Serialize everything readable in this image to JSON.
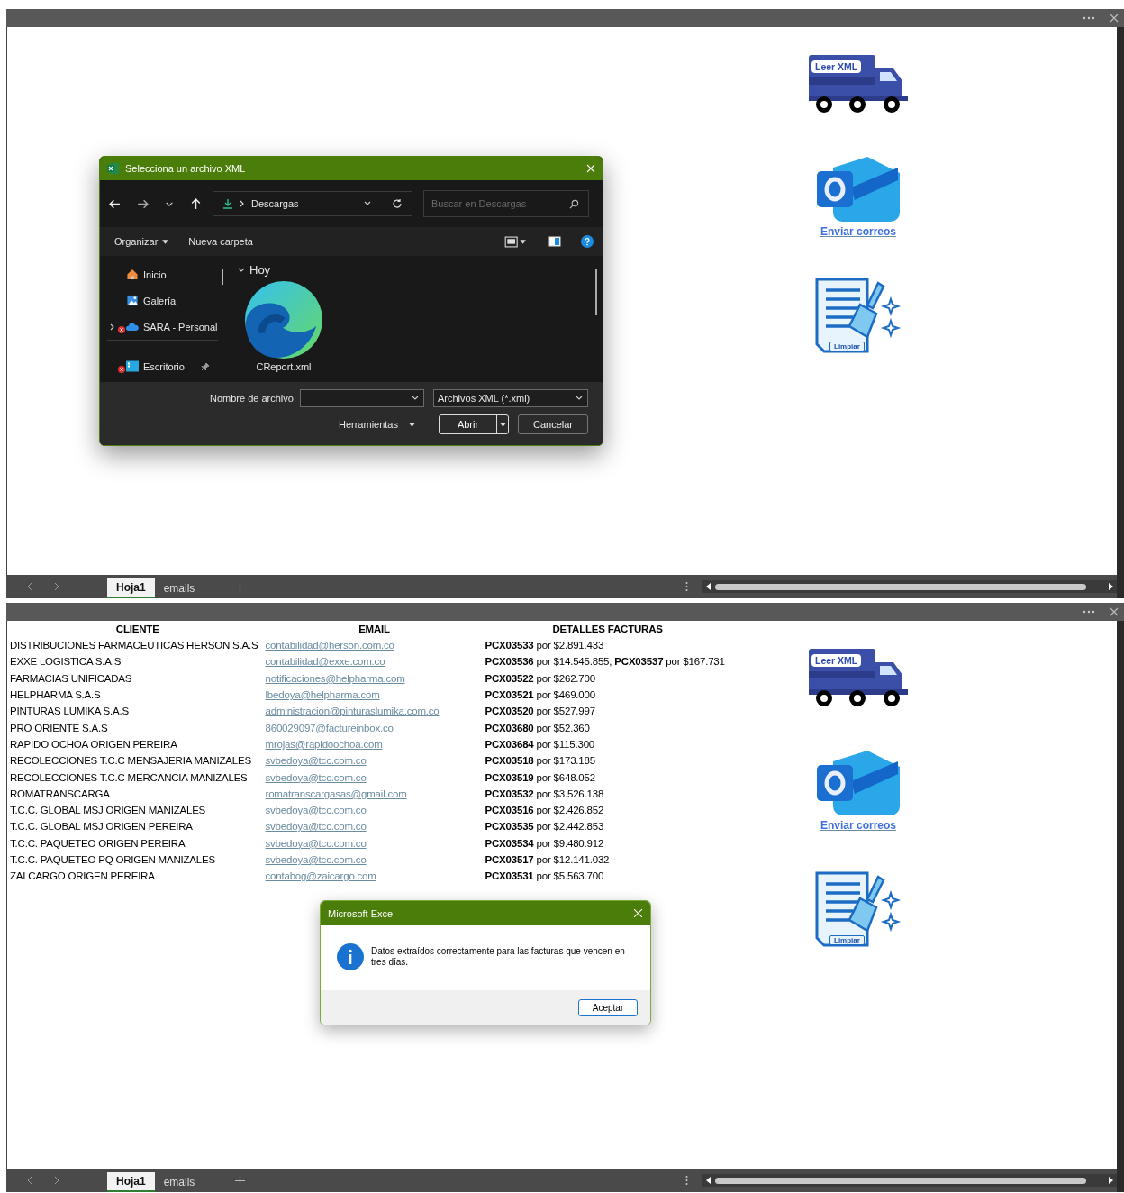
{
  "panels": [
    {
      "macro_buttons": [
        {
          "kind": "truck",
          "label": "Leer XML"
        },
        {
          "kind": "mail",
          "label": "Enviar correos"
        },
        {
          "kind": "clean",
          "label": "Limpiar"
        }
      ],
      "file_dialog": {
        "title": "Selecciona un archivo XML",
        "path": "Descargas",
        "search_placeholder": "Buscar en Descargas",
        "toolbar": [
          "Organizar",
          "Nueva carpeta"
        ],
        "nav_items": [
          {
            "kind": "home",
            "label": "Inicio",
            "error": false
          },
          {
            "kind": "gallery",
            "label": "Galería",
            "error": false
          },
          {
            "kind": "cloud",
            "label": "SARA - Personal",
            "error": true
          },
          {
            "kind": "desktop",
            "label": "Escritorio",
            "error": true
          }
        ],
        "group": "Hoy",
        "files": [
          {
            "name": "CReport.xml"
          }
        ],
        "filename_label": "Nombre de archivo:",
        "filetype": "Archivos XML (*.xml)",
        "tools": "Herramientas",
        "open": "Abrir",
        "cancel": "Cancelar"
      },
      "sheet_tabs": [
        {
          "label": "Hoja1",
          "selected": true
        },
        {
          "label": "emails",
          "selected": false
        }
      ]
    },
    {
      "table": {
        "columns": [
          "CLIENTE",
          "EMAIL",
          "DETALLES FACTURAS"
        ],
        "rows": [
          [
            "DISTRIBUCIONES FARMACEUTICAS HERSON S.A.S",
            "contabilidad@herson.com.co",
            "**PCX03533** por $2.891.433"
          ],
          [
            "EXXE LOGISTICA S.A.S",
            "contabilidad@exxe.com.co",
            "**PCX03536** por $14.545.855, **PCX03537** por $167.731"
          ],
          [
            "FARMACIAS UNIFICADAS",
            "notificaciones@helpharma.com",
            "**PCX03522** por $262.700"
          ],
          [
            "HELPHARMA S.A.S",
            "lbedoya@helpharma.com",
            "**PCX03521** por $469.000"
          ],
          [
            "PINTURAS LUMIKA S.A.S",
            "administracion@pinturaslumika.com.co",
            "**PCX03520** por $527.997"
          ],
          [
            "PRO ORIENTE S.A.S",
            "860029097@factureinbox.co",
            "**PCX03680** por $52.360"
          ],
          [
            "RAPIDO OCHOA ORIGEN PEREIRA",
            "mrojas@rapidoochoa.com",
            "**PCX03684** por $115.300"
          ],
          [
            "RECOLECCIONES T.C.C MENSAJERIA MANIZALES",
            "svbedoya@tcc.com.co",
            "**PCX03518** por $173.185"
          ],
          [
            "RECOLECCIONES T.C.C MERCANCIA MANIZALES",
            "svbedoya@tcc.com.co",
            "**PCX03519** por $648.052"
          ],
          [
            "ROMATRANSCARGA",
            "romatranscargasas@gmail.com",
            "**PCX03532** por $3.526.138"
          ],
          [
            "T.C.C.  GLOBAL MSJ ORIGEN MANIZALES",
            "svbedoya@tcc.com.co",
            "**PCX03516** por $2.426.852"
          ],
          [
            "T.C.C. GLOBAL MSJ ORIGEN PEREIRA",
            "svbedoya@tcc.com.co",
            "**PCX03535** por $2.442.853"
          ],
          [
            "T.C.C. PAQUETEO ORIGEN PEREIRA",
            "svbedoya@tcc.com.co",
            "**PCX03534** por $9.480.912"
          ],
          [
            "T.C.C. PAQUETEO PQ ORIGEN MANIZALES",
            "svbedoya@tcc.com.co",
            "**PCX03517** por $12.141.032"
          ],
          [
            "ZAI CARGO ORIGEN PEREIRA",
            "contabog@zaicargo.com",
            "**PCX03531** por $5.563.700"
          ]
        ]
      },
      "macro_buttons": [
        {
          "kind": "truck",
          "label": "Leer XML"
        },
        {
          "kind": "mail",
          "label": "Enviar correos"
        },
        {
          "kind": "clean",
          "label": "Limpiar"
        }
      ],
      "message_box": {
        "title": "Microsoft Excel",
        "message": "Datos extraídos correctamente para las facturas que vencen en tres días.",
        "button": "Aceptar"
      },
      "sheet_tabs": [
        {
          "label": "Hoja1",
          "selected": true
        },
        {
          "label": "emails",
          "selected": false
        }
      ]
    }
  ]
}
